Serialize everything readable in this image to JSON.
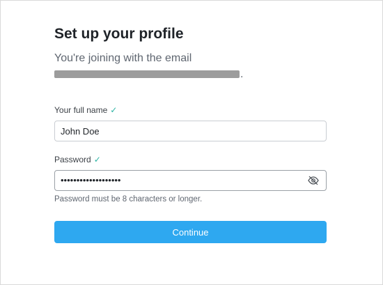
{
  "title": "Set up your profile",
  "subtitle": "You're joining with the email",
  "email_trailing": ".",
  "fullname": {
    "label": "Your full name",
    "check": "✓",
    "value": "John Doe"
  },
  "password": {
    "label": "Password",
    "check": "✓",
    "masked_value": "•••••••••••••••••••",
    "hint": "Password must be 8 characters or longer."
  },
  "continue_label": "Continue",
  "colors": {
    "accent": "#2ea8f0",
    "check": "#2bb3a3"
  },
  "icons": {
    "password_toggle": "eye-slash-icon"
  }
}
